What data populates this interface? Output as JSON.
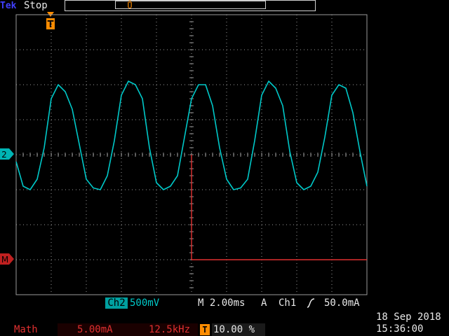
{
  "topbar": {
    "brand": "Tek",
    "run_state": "Stop"
  },
  "markers": {
    "trigger_position": "T",
    "record_marker": "Ů",
    "ch2": "2",
    "math": "M"
  },
  "readout": {
    "ch2_label": "Ch2",
    "ch2_scale": "500mV",
    "timebase": "M 2.00ms",
    "trigger_mode": "A",
    "trigger_source": "Ch1",
    "trigger_level": "50.0mA"
  },
  "math": {
    "label": "Math",
    "scale": "5.00mA",
    "frequency": "12.5kHz"
  },
  "trigger_position_pct": "10.00 %",
  "trigger_icon": "T",
  "clock": {
    "date": "18 Sep 2018",
    "time": "15:36:00"
  },
  "colors": {
    "ch2": "#00c8c8",
    "math": "#e03030",
    "trigger": "#ff8c00",
    "graticule": "#9a9a9a"
  },
  "chart_data": {
    "type": "line",
    "grid": true,
    "xlim": [
      0,
      20
    ],
    "x_unit": "ms",
    "series": [
      {
        "name": "Ch2",
        "color": "#00c8c8",
        "x": [
          0,
          0.4,
          0.8,
          1.2,
          1.6,
          2.0,
          2.4,
          2.8,
          3.2,
          3.6,
          4.0,
          4.4,
          4.8,
          5.2,
          5.6,
          6.0,
          6.4,
          6.8,
          7.2,
          7.6,
          8.0,
          8.4,
          8.8,
          9.2,
          9.6,
          10.0,
          10.4,
          10.8,
          11.2,
          11.6,
          12.0,
          12.4,
          12.8,
          13.2,
          13.6,
          14.0,
          14.4,
          14.8,
          15.2,
          15.6,
          16.0,
          16.4,
          16.8,
          17.2,
          17.6,
          18.0,
          18.4,
          18.8,
          19.2,
          19.6,
          20.0
        ],
        "y": [
          -0.2,
          -0.9,
          -1.0,
          -0.7,
          0.2,
          1.6,
          2.0,
          1.8,
          1.3,
          0.3,
          -0.7,
          -0.95,
          -1.0,
          -0.6,
          0.4,
          1.7,
          2.1,
          2.0,
          1.6,
          0.2,
          -0.8,
          -1.0,
          -0.9,
          -0.6,
          0.5,
          1.6,
          2.0,
          2.0,
          1.4,
          0.2,
          -0.7,
          -1.0,
          -0.95,
          -0.7,
          0.4,
          1.7,
          2.1,
          1.9,
          1.4,
          0.1,
          -0.8,
          -1.0,
          -0.9,
          -0.5,
          0.5,
          1.7,
          2.0,
          1.9,
          1.2,
          0.1,
          -0.9
        ]
      },
      {
        "name": "Math",
        "color": "#e03030",
        "x": [
          10,
          20
        ],
        "y": [
          0,
          0
        ]
      }
    ]
  }
}
